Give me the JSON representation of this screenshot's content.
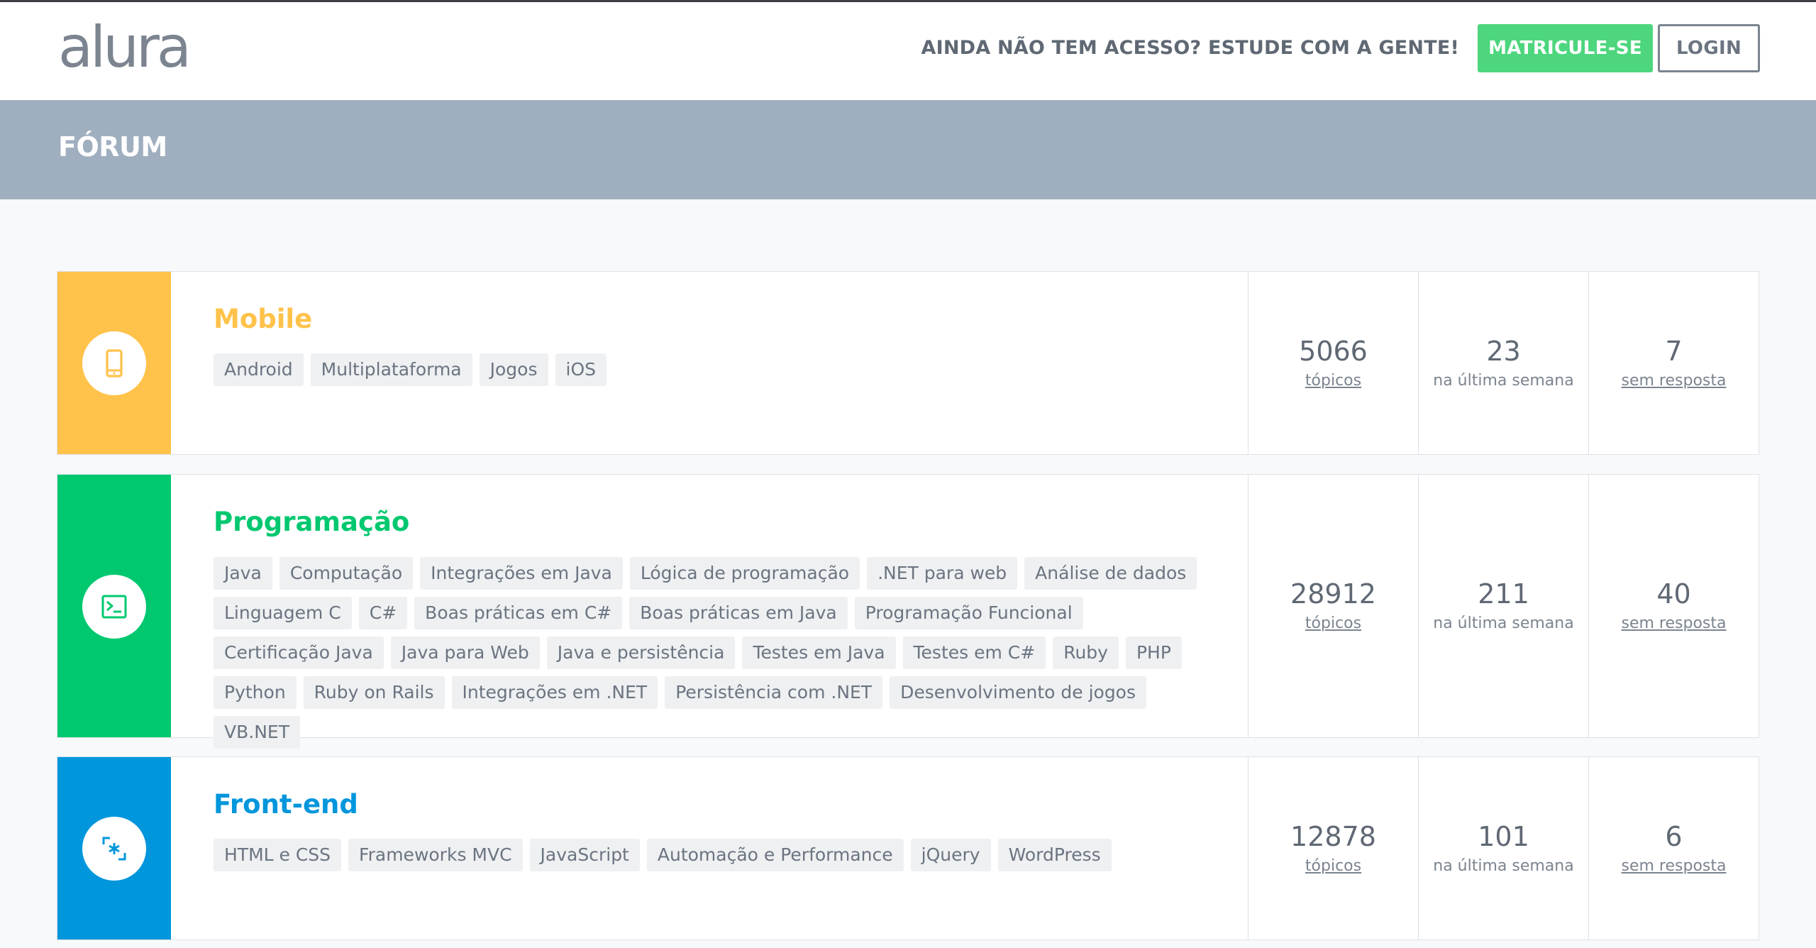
{
  "header": {
    "logo": "alura",
    "cta_text": "AINDA NÃO TEM ACESSO? ESTUDE COM A GENTE!",
    "enroll_label": "MATRICULE-SE",
    "login_label": "LOGIN"
  },
  "page_title": "FÓRUM",
  "colors": {
    "mobile": "#ffc24a",
    "programacao": "#00c86f",
    "frontend": "#0096dc",
    "enroll": "#4dd67d",
    "title_bar": "#a0afbf"
  },
  "categories": [
    {
      "title": "Mobile",
      "icon": "smartphone-icon",
      "tags": [
        "Android",
        "Multiplataforma",
        "Jogos",
        "iOS"
      ],
      "topics": "5066",
      "topics_label": "tópicos",
      "last_week": "23",
      "last_week_label": "na última semana",
      "unanswered": "7",
      "unanswered_label": "sem resposta"
    },
    {
      "title": "Programação",
      "icon": "terminal-icon",
      "tags": [
        "Java",
        "Computação",
        "Integrações em Java",
        "Lógica de programação",
        ".NET para web",
        "Análise de dados",
        "Linguagem C",
        "C#",
        "Boas práticas em C#",
        "Boas práticas em Java",
        "Programação Funcional",
        "Certificação Java",
        "Java para Web",
        "Java e persistência",
        "Testes em Java",
        "Testes em C#",
        "Ruby",
        "PHP",
        "Python",
        "Ruby on Rails",
        "Integrações em .NET",
        "Persistência com .NET",
        "Desenvolvimento de jogos",
        "VB.NET"
      ],
      "topics": "28912",
      "topics_label": "tópicos",
      "last_week": "211",
      "last_week_label": "na última semana",
      "unanswered": "40",
      "unanswered_label": "sem resposta"
    },
    {
      "title": "Front-end",
      "icon": "frontend-brackets-icon",
      "tags": [
        "HTML e CSS",
        "Frameworks MVC",
        "JavaScript",
        "Automação e Performance",
        "jQuery",
        "WordPress"
      ],
      "topics": "12878",
      "topics_label": "tópicos",
      "last_week": "101",
      "last_week_label": "na última semana",
      "unanswered": "6",
      "unanswered_label": "sem resposta"
    }
  ]
}
